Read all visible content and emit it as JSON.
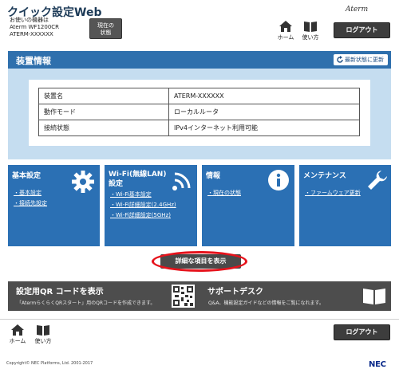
{
  "header": {
    "app_title": "クイック設定Web",
    "device_lines": [
      "お使いの機器は",
      "Aterm WF1200CR",
      "ATERM-XXXXXX"
    ],
    "now_button": [
      "現在の",
      "状態"
    ],
    "logo": "Aterm",
    "home_label": "ホーム",
    "howto_label": "使い方",
    "logout_label": "ログアウト"
  },
  "device_info": {
    "title": "装置情報",
    "refresh_label": "最新状態に更新",
    "rows": [
      {
        "key": "装置名",
        "value": "ATERM-XXXXXX"
      },
      {
        "key": "動作モード",
        "value": "ローカルルータ"
      },
      {
        "key": "接続状態",
        "value": "IPv4インターネット利用可能"
      }
    ]
  },
  "tiles": [
    {
      "title": "基本設定",
      "links": [
        "基本設定",
        "接続先設定"
      ]
    },
    {
      "title": "Wi-Fi(無線LAN)設定",
      "links": [
        "Wi-Fi基本設定",
        "Wi-Fi詳細設定(2.4GHz)",
        "Wi-Fi詳細設定(5GHz)"
      ]
    },
    {
      "title": "情報",
      "links": [
        "現在の状態"
      ]
    },
    {
      "title": "メンテナンス",
      "links": [
        "ファームウェア更新"
      ]
    }
  ],
  "detail_button": "詳細な項目を表示",
  "bottom": {
    "qr": {
      "title": "設定用QR コードを表示",
      "desc": "「AtermらくらくQRスタート」用のQRコードを作成できます。"
    },
    "support": {
      "title": "サポートデスク",
      "desc": "Q&A、機能設定ガイドなどの情報をご覧になれます。"
    }
  },
  "footer": {
    "home_label": "ホーム",
    "howto_label": "使い方",
    "logout_label": "ログアウト",
    "copyright": "Copyright© NEC Platforms, Ltd. 2001-2017",
    "brand": "NEC"
  },
  "colors": {
    "accent_blue": "#2b70b4",
    "light_blue": "#c5ddf0",
    "highlight_red": "#e6121b",
    "nec_blue": "#0a2a8a"
  }
}
